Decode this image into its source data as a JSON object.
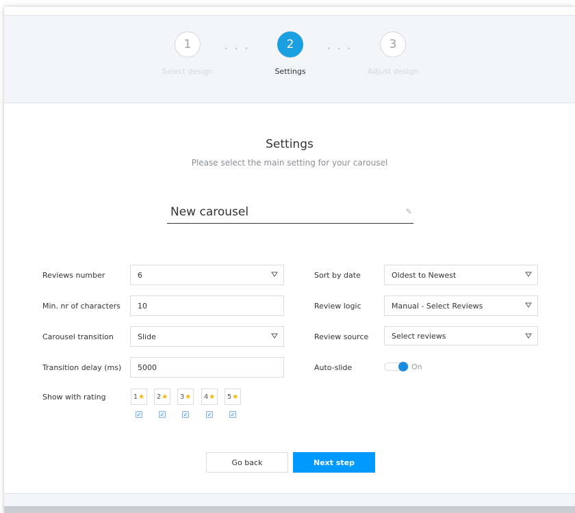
{
  "stepper": {
    "steps": [
      {
        "number": "1",
        "label": "Select design"
      },
      {
        "number": "2",
        "label": "Settings"
      },
      {
        "number": "3",
        "label": "Adjust design"
      }
    ],
    "active_step": 2
  },
  "header": {
    "title": "Settings",
    "subtitle": "Please select the main setting for your carousel"
  },
  "carousel_name": {
    "value": "New carousel"
  },
  "form": {
    "reviews_number": {
      "label": "Reviews number",
      "value": "6"
    },
    "min_characters": {
      "label": "Min. nr of characters",
      "value": "10"
    },
    "carousel_transition": {
      "label": "Carousel transition",
      "value": "Slide"
    },
    "transition_delay": {
      "label": "Transition delay (ms)",
      "value": "5000"
    },
    "show_with_rating": {
      "label": "Show with rating",
      "ratings": [
        {
          "value": "1",
          "checked": true
        },
        {
          "value": "2",
          "checked": true
        },
        {
          "value": "3",
          "checked": true
        },
        {
          "value": "4",
          "checked": true
        },
        {
          "value": "5",
          "checked": true
        }
      ]
    },
    "sort_by_date": {
      "label": "Sort by date",
      "value": "Oldest to Newest"
    },
    "review_logic": {
      "label": "Review logic",
      "value": "Manual - Select Reviews"
    },
    "review_source": {
      "label": "Review source",
      "value": "Select reviews"
    },
    "auto_slide": {
      "label": "Auto-slide",
      "state": "On"
    }
  },
  "actions": {
    "back_label": "Go back",
    "next_label": "Next step"
  },
  "colors": {
    "accent": "#1a9fe0",
    "next_button": "#0099ff",
    "star": "#f4b400"
  }
}
